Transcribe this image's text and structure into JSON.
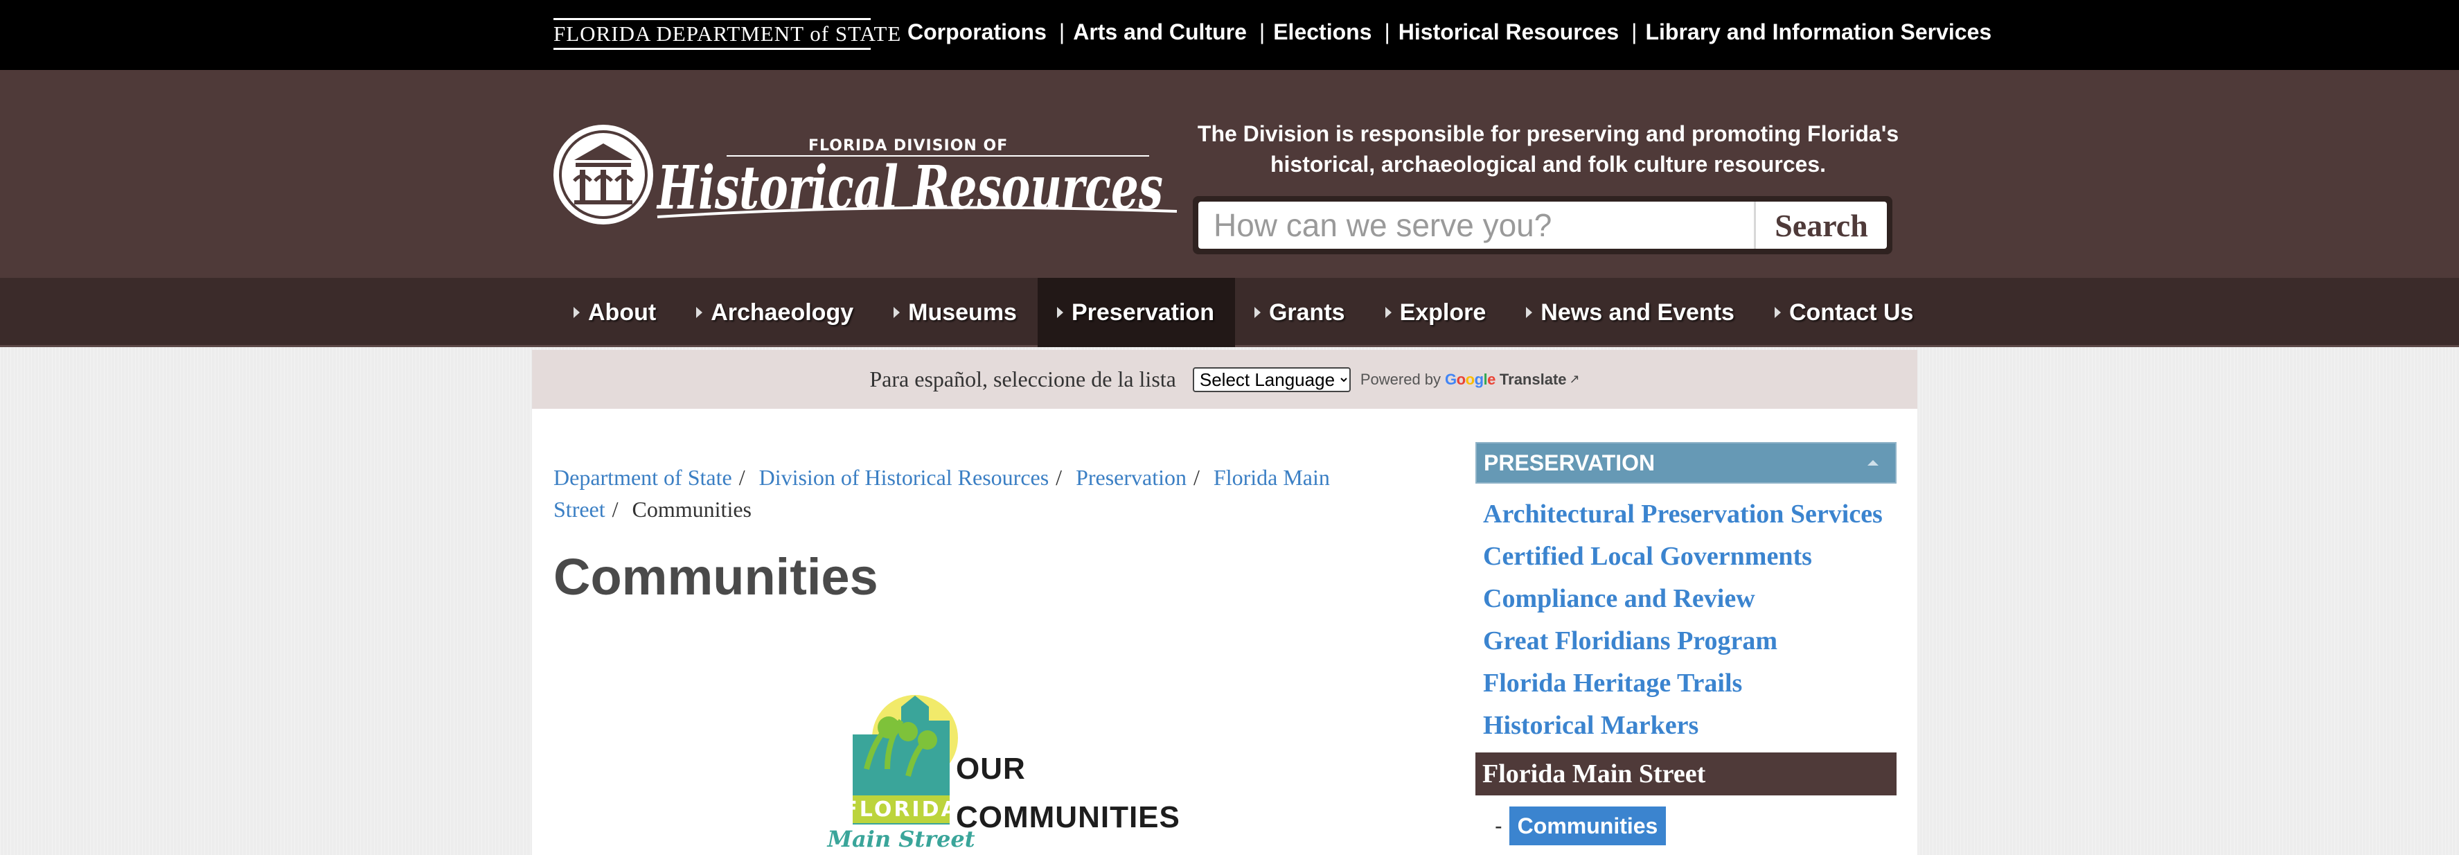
{
  "topbar": {
    "dos_logo": "FLORIDA DEPARTMENT of STATE",
    "links": [
      "Corporations",
      "Arts and Culture",
      "Elections",
      "Historical Resources",
      "Library and Information Services"
    ]
  },
  "header": {
    "logo_small": "FLORIDA DIVISION OF",
    "logo_big": "Historical Resources",
    "tagline": "The Division is responsible for preserving and promoting Florida's historical, archaeological and folk culture resources.",
    "search_placeholder": "How can we serve you?",
    "search_button": "Search",
    "colors": {
      "header_bg": "#4f3a39",
      "nav_bg": "#3b2b2a"
    }
  },
  "mainnav": {
    "items": [
      "About",
      "Archaeology",
      "Museums",
      "Preservation",
      "Grants",
      "Explore",
      "News and Events",
      "Contact Us"
    ],
    "active": "Preservation"
  },
  "translate": {
    "label": "Para español, seleccione de la lista",
    "select_value": "Select Language",
    "powered": "Powered by",
    "google": "Google",
    "translate": "Translate"
  },
  "breadcrumb": [
    "Department of State",
    "Division of Historical Resources",
    "Preservation",
    "Florida Main Street",
    "Communities"
  ],
  "page": {
    "title": "Communities",
    "logo_text_1": "FLORIDA",
    "logo_text_2": "Main Street",
    "our_1": "OUR",
    "our_2": "COMMUNITIES"
  },
  "sidebar": {
    "heading": "PRESERVATION",
    "links": [
      "Architectural Preservation Services",
      "Certified Local Governments",
      "Compliance and Review",
      "Great Floridians Program",
      "Florida Heritage Trails",
      "Historical Markers"
    ],
    "section": "Florida Main Street",
    "sub_item": "Communities"
  }
}
